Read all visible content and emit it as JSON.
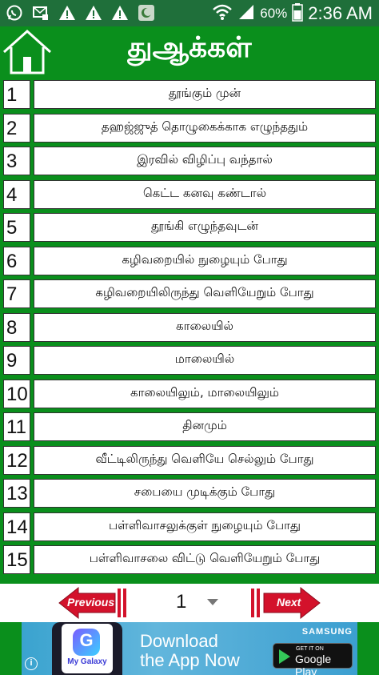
{
  "status_bar": {
    "battery_percent": "60%",
    "time": "2:36 AM",
    "icons": [
      "whatsapp-icon",
      "message-icon",
      "warning-icon",
      "warning-icon",
      "warning-icon",
      "app-icon",
      "wifi-icon",
      "signal-icon",
      "battery-icon"
    ]
  },
  "header": {
    "title": "துஆக்கள்",
    "home_icon": "home-icon"
  },
  "list": {
    "items": [
      {
        "num": "1",
        "label": "தூங்கும் முன்"
      },
      {
        "num": "2",
        "label": "தஹஜ்ஜுத் தொழுகைக்காக எழுந்ததும்"
      },
      {
        "num": "3",
        "label": "இரவில் விழிப்பு வந்தால்"
      },
      {
        "num": "4",
        "label": "கெட்ட கனவு கண்டால்"
      },
      {
        "num": "5",
        "label": "தூங்கி எழுந்தவுடன்"
      },
      {
        "num": "6",
        "label": "கழிவறையில் நுழையும் போது"
      },
      {
        "num": "7",
        "label": "கழிவறையிலிருந்து வெளியேறும் போது"
      },
      {
        "num": "8",
        "label": "காலையில்"
      },
      {
        "num": "9",
        "label": "மாலையில்"
      },
      {
        "num": "10",
        "label": "காலையிலும், மாலையிலும்"
      },
      {
        "num": "11",
        "label": "தினமும்"
      },
      {
        "num": "12",
        "label": "வீட்டிலிருந்து வெளியே செல்லும் போது"
      },
      {
        "num": "13",
        "label": "சபையை முடிக்கும் போது"
      },
      {
        "num": "14",
        "label": "பள்ளிவாசலுக்குள் நுழையும் போது"
      },
      {
        "num": "15",
        "label": "பள்ளிவாசலை விட்டு வெளியேறும் போது"
      }
    ]
  },
  "pagination": {
    "prev_label": "Previous",
    "next_label": "Next",
    "current_page": "1"
  },
  "ad": {
    "brand": "SAMSUNG",
    "app_name": "My Galaxy",
    "headline_line1": "Download",
    "headline_line2": "the App Now",
    "store_small": "GET IT ON",
    "store_big": "Google Play",
    "info": "i"
  },
  "colors": {
    "status_bar": "#1f6f3a",
    "primary_green": "#0a8f1c",
    "pager_red": "#d3122b"
  }
}
